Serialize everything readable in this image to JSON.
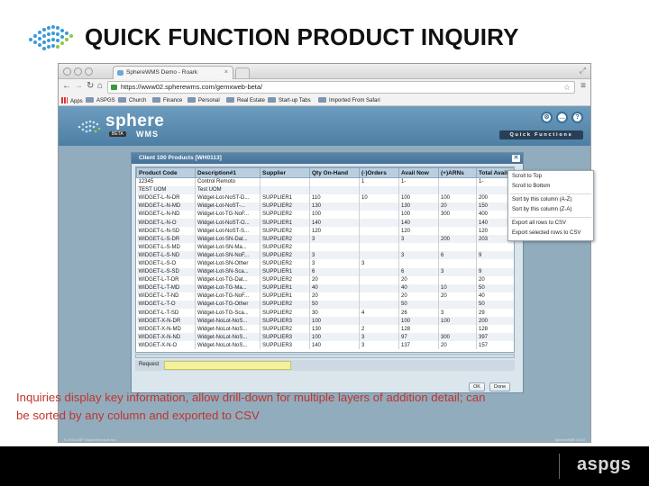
{
  "slide": {
    "title": "QUICK FUNCTION PRODUCT INQUIRY",
    "caption": "Inquiries display key information, allow drill-down for multiple layers of addition detail; can be sorted by any column and exported to CSV",
    "footer_brand": "aspgs",
    "colors": {
      "caption": "#c0342b",
      "title": "#111111",
      "footer": "#000000"
    }
  },
  "browser": {
    "tab_title": "SphereWMS Demo - Roark",
    "url": "https://www02.spherewms.com/gemxweb-beta/",
    "bookmarks": [
      "Apps",
      "ASPGS",
      "Church",
      "Finance",
      "Personal",
      "Real Estate",
      "Start-up Tabs",
      "Imported From Safari"
    ]
  },
  "app": {
    "brand": "sphere",
    "badge": "BETA",
    "subbrand": "WMS",
    "quick_functions_label": "Quick Functions",
    "footer_left": "© 2014 ASP Global Services Inc.",
    "footer_right": "SphereWMS v3.00",
    "accent": "#4d7fa5"
  },
  "dialog": {
    "title": "Client 100 Products [WH0113]",
    "columns": [
      "Product Code",
      "Description#1",
      "Supplier",
      "Qty On-Hand",
      "(-)Orders",
      "Avail Now",
      "(+)ARNs",
      "Total Avail"
    ],
    "rows": [
      [
        "12345",
        "Control Remoto",
        "",
        "",
        "1",
        "1-",
        "",
        "1-"
      ],
      [
        "TEST UOM",
        "Test UOM",
        "",
        "",
        "",
        "",
        "",
        ""
      ],
      [
        "WIDGET-L-N-DR",
        "Widget-Lot-NoST-D...",
        "SUPPLIER1",
        "110",
        "10",
        "100",
        "100",
        "200"
      ],
      [
        "WIDGET-L-N-MD",
        "Widget-Lot-NoST-...",
        "SUPPLIER2",
        "130",
        "",
        "130",
        "20",
        "150"
      ],
      [
        "WIDGET-L-N-ND",
        "Widget-Lot-TG-NoF...",
        "SUPPLIER2",
        "100",
        "",
        "100",
        "300",
        "400"
      ],
      [
        "WIDGET-L-N-O",
        "Widget-Lot-NoST-O...",
        "SUPPLIER1",
        "140",
        "",
        "140",
        "",
        "140"
      ],
      [
        "WIDGET-L-N-SD",
        "Widget-Lot-NoST-S...",
        "SUPPLIER2",
        "120",
        "",
        "120",
        "",
        "120"
      ],
      [
        "WIDGET-L-S-DR",
        "Widget-Lot-SN-Dat...",
        "SUPPLIER2",
        "3",
        "",
        "3",
        "200",
        "203"
      ],
      [
        "WIDGET-L-S-MD",
        "Widget-Lot-SN-Ma...",
        "SUPPLIER2",
        "",
        "",
        "",
        "",
        ""
      ],
      [
        "WIDGET-L-S-ND",
        "Widget-Lot-SN-NoF...",
        "SUPPLIER2",
        "3",
        "",
        "3",
        "6",
        "9"
      ],
      [
        "WIDGET-L-S-O",
        "Widget-Lot-SN-Other",
        "SUPPLIER2",
        "3",
        "3",
        "",
        "",
        ""
      ],
      [
        "WIDGET-L-S-SD",
        "Widget-Lot-SN-Sca...",
        "SUPPLIER1",
        "6",
        "",
        "6",
        "3",
        "9"
      ],
      [
        "WIDGET-L-T-DR",
        "Widget-Lot-TG-Dat...",
        "SUPPLIER2",
        "20",
        "",
        "20",
        "",
        "20"
      ],
      [
        "WIDGET-L-T-MD",
        "Widget-Lot-TG-Ma...",
        "SUPPLIER1",
        "40",
        "",
        "40",
        "10",
        "50"
      ],
      [
        "WIDGET-L-T-ND",
        "Widget-Lot-TG-NoF...",
        "SUPPLIER1",
        "20",
        "",
        "20",
        "20",
        "40"
      ],
      [
        "WIDGET-L-T-O",
        "Widget-Lot-TG-Other",
        "SUPPLIER2",
        "50",
        "",
        "50",
        "",
        "50"
      ],
      [
        "WIDGET-L-T-SD",
        "Widget-Lot-TG-Sca...",
        "SUPPLIER2",
        "30",
        "4",
        "26",
        "3",
        "29"
      ],
      [
        "WIDGET-X-N-DR",
        "Widget-NoLot-NoS...",
        "SUPPLIER3",
        "100",
        "",
        "100",
        "100",
        "200"
      ],
      [
        "WIDGET-X-N-MD",
        "Widget-NoLot-NoS...",
        "SUPPLIER2",
        "130",
        "2",
        "128",
        "",
        "128"
      ],
      [
        "WIDGET-X-N-ND",
        "Widget-NoLot-NoS...",
        "SUPPLIER3",
        "100",
        "3",
        "97",
        "300",
        "397"
      ],
      [
        "WIDGET-X-N-O",
        "Widget-NoLot-NoS...",
        "SUPPLIER3",
        "140",
        "3",
        "137",
        "20",
        "157"
      ]
    ],
    "request_label": "Request",
    "request_value": "",
    "ok_label": "OK",
    "done_label": "Done"
  },
  "context_menu": {
    "items": [
      "Scroll to Top",
      "Scroll to Bottom",
      "Sort by this column (A-Z)",
      "Sort by this column (Z-A)",
      "Export all rows to CSV",
      "Export selected rows to CSV"
    ]
  }
}
